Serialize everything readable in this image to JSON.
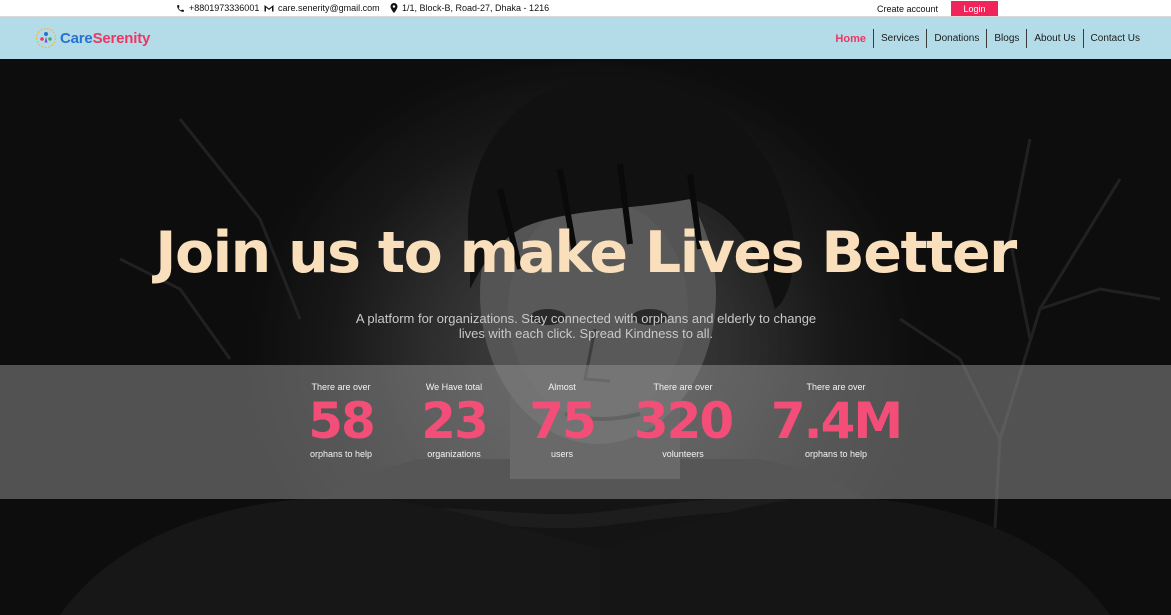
{
  "topbar": {
    "phone": "+8801973336001",
    "email": "care.senerity@gmail.com",
    "address": "1/1, Block-B, Road-27, Dhaka - 1216",
    "create_account": "Create account",
    "login": "Login"
  },
  "brand": {
    "part1": "Care",
    "part2": "Serenity"
  },
  "nav": {
    "home": "Home",
    "services": "Services",
    "donations": "Donations",
    "blogs": "Blogs",
    "about": "About Us",
    "contact": "Contact Us"
  },
  "hero": {
    "title": "Join us to make Lives Better",
    "subtitle": "A platform for organizations. Stay connected with orphans and elderly to change lives with each click. Spread Kindness to all."
  },
  "stats": [
    {
      "pre": "There are over",
      "value": "58",
      "post": "orphans to help"
    },
    {
      "pre": "We Have total",
      "value": "23",
      "post": "organizations"
    },
    {
      "pre": "Almost",
      "value": "75",
      "post": "users"
    },
    {
      "pre": "There are over",
      "value": "320",
      "post": "volunteers"
    },
    {
      "pre": "There are over",
      "value": "7.4M",
      "post": "orphans to help"
    }
  ],
  "colors": {
    "accent": "#ef3564",
    "stat_number": "#f24e78",
    "navbar": "#b3dce8",
    "title": "#f9dfbb"
  },
  "icons": {
    "phone": "phone-icon",
    "email": "gmail-icon",
    "address": "location-pin-icon",
    "logo": "care-serenity-logo-icon"
  }
}
